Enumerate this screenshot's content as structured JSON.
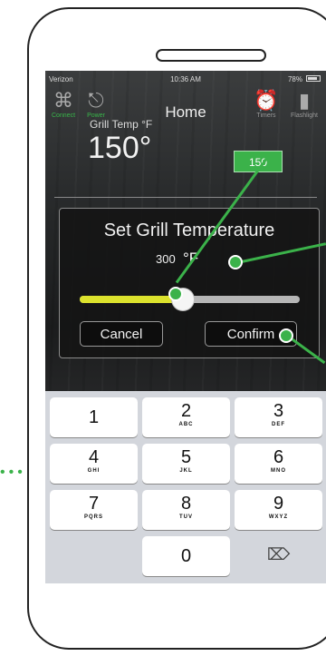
{
  "status_bar": {
    "carrier": "Verizon",
    "time": "10:36 AM",
    "battery": "78%"
  },
  "topbar": {
    "title": "Home",
    "connect_label": "Connect",
    "power_label": "Power",
    "timers_label": "Timers",
    "flashlight_label": "Flashlight"
  },
  "grill": {
    "temp_label": "Grill Temp °F",
    "temp_value": "150°",
    "set_value": "150"
  },
  "dialog": {
    "title": "Set Grill Temperature",
    "input_value": "300",
    "unit": "°F",
    "slider_level": 0.47,
    "cancel_label": "Cancel",
    "confirm_label": "Confirm"
  },
  "keypad": {
    "keys": [
      {
        "digit": "1",
        "letters": ""
      },
      {
        "digit": "2",
        "letters": "ABC"
      },
      {
        "digit": "3",
        "letters": "DEF"
      },
      {
        "digit": "4",
        "letters": "GHI"
      },
      {
        "digit": "5",
        "letters": "JKL"
      },
      {
        "digit": "6",
        "letters": "MNO"
      },
      {
        "digit": "7",
        "letters": "PQRS"
      },
      {
        "digit": "8",
        "letters": "TUV"
      },
      {
        "digit": "9",
        "letters": "WXYZ"
      },
      {
        "digit": "0",
        "letters": ""
      }
    ],
    "backspace_icon": "backspace-icon"
  },
  "colors": {
    "accent": "#3bb24a",
    "slider_fill": "#dce22d",
    "screen_bg": "#252728",
    "keyboard_bg": "#d3d6dc"
  }
}
